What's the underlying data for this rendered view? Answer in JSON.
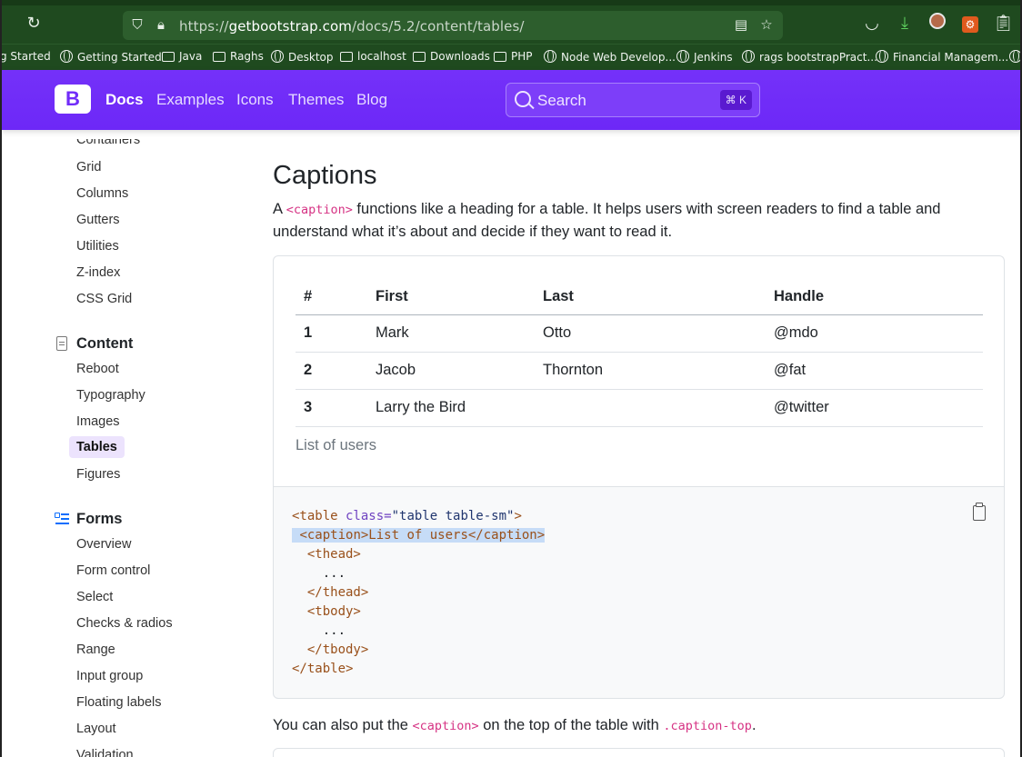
{
  "browser": {
    "url_prefix": "https://",
    "url_host": "getbootstrap.com",
    "url_path": "/docs/5.2/content/tables/"
  },
  "bookmarks": [
    {
      "label": "g Started",
      "icon": "none"
    },
    {
      "label": "Getting Started",
      "icon": "globe-icon"
    },
    {
      "label": "Java",
      "icon": "folder-icon"
    },
    {
      "label": "Raghs",
      "icon": "folder-icon"
    },
    {
      "label": "Desktop",
      "icon": "globe-icon"
    },
    {
      "label": "localhost",
      "icon": "folder-icon"
    },
    {
      "label": "Downloads",
      "icon": "folder-icon"
    },
    {
      "label": "PHP",
      "icon": "folder-icon"
    },
    {
      "label": "Node Web Develop...",
      "icon": "globe-icon"
    },
    {
      "label": "Jenkins",
      "icon": "globe-icon"
    },
    {
      "label": "rags bootstrapPract...",
      "icon": "globe-icon"
    },
    {
      "label": "Financial Managem...",
      "icon": "globe-icon"
    }
  ],
  "navbar": {
    "logo": "B",
    "links": [
      "Docs",
      "Examples",
      "Icons",
      "Themes",
      "Blog"
    ],
    "search_placeholder": "Search",
    "search_shortcut": "⌘ K"
  },
  "sidebar": {
    "layout_items_partial": "Containers",
    "layout_items": [
      "Grid",
      "Columns",
      "Gutters",
      "Utilities",
      "Z-index",
      "CSS Grid"
    ],
    "content_heading": "Content",
    "content_items": [
      "Reboot",
      "Typography",
      "Images",
      "Tables",
      "Figures"
    ],
    "content_active": "Tables",
    "forms_heading": "Forms",
    "forms_items": [
      "Overview",
      "Form control",
      "Select",
      "Checks & radios",
      "Range",
      "Input group",
      "Floating labels",
      "Layout"
    ],
    "forms_partial": "Validation"
  },
  "main": {
    "heading": "Captions",
    "intro_a": "A ",
    "intro_code": "<caption>",
    "intro_b": " functions like a heading for a table. It helps users with screen readers to find a table and understand what it’s about and decide if they want to read it.",
    "table": {
      "headers": [
        "#",
        "First",
        "Last",
        "Handle"
      ],
      "rows": [
        [
          "1",
          "Mark",
          "Otto",
          "@mdo"
        ],
        [
          "2",
          "Jacob",
          "Thornton",
          "@fat"
        ],
        [
          "3",
          "Larry the Bird",
          "",
          "@twitter"
        ]
      ],
      "caption": "List of users"
    },
    "code": {
      "line1_tag_open": "<table",
      "line1_attr": " class=",
      "line1_str": "\"table table-sm\"",
      "line1_close": ">",
      "line2": "<caption>List of users</caption>",
      "line3": "<thead>",
      "line4": "...",
      "line5": "</thead>",
      "line6": "<tbody>",
      "line7": "...",
      "line8": "</tbody>",
      "line9": "</table>"
    },
    "outro_a": "You can also put the ",
    "outro_code1": "<caption>",
    "outro_b": " on the top of the table with ",
    "outro_code2": ".caption-top",
    "outro_c": "."
  }
}
